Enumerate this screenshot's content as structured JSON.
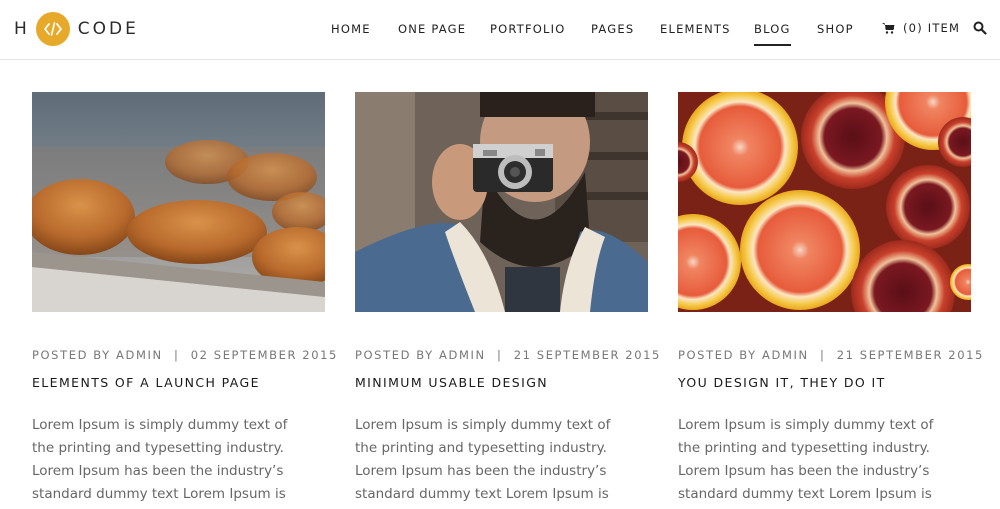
{
  "brand": {
    "left": "H",
    "right": "CODE",
    "accent": "#e6a92a"
  },
  "nav": {
    "items": [
      "HOME",
      "ONE PAGE",
      "PORTFOLIO",
      "PAGES",
      "ELEMENTS",
      "BLOG",
      "SHOP"
    ],
    "active": "BLOG",
    "cart_label": "(0) ITEM"
  },
  "posts": [
    {
      "meta_prefix": "POSTED BY",
      "author": "ADMIN",
      "separator": "|",
      "date": "02 SEPTEMBER 2015",
      "title": "ELEMENTS OF A LAUNCH PAGE",
      "excerpt": "Lorem Ipsum is simply dummy text of the printing and typesetting industry. Lorem Ipsum has been the industry’s standard dummy text Lorem Ipsum is simply",
      "image": "croissants-photo"
    },
    {
      "meta_prefix": "POSTED BY",
      "author": "ADMIN",
      "separator": "|",
      "date": "21 SEPTEMBER 2015",
      "title": "MINIMUM USABLE DESIGN",
      "excerpt": "Lorem Ipsum is simply dummy text of the printing and typesetting industry. Lorem Ipsum has been the industry’s standard dummy text Lorem Ipsum is simply",
      "image": "man-with-camera-photo"
    },
    {
      "meta_prefix": "POSTED BY",
      "author": "ADMIN",
      "separator": "|",
      "date": "21 SEPTEMBER 2015",
      "title": "YOU DESIGN IT, THEY DO IT",
      "excerpt": "Lorem Ipsum is simply dummy text of the printing and typesetting industry. Lorem Ipsum has been the industry’s standard dummy text Lorem Ipsum is simply",
      "image": "grapefruit-pomegranate-photo"
    }
  ]
}
